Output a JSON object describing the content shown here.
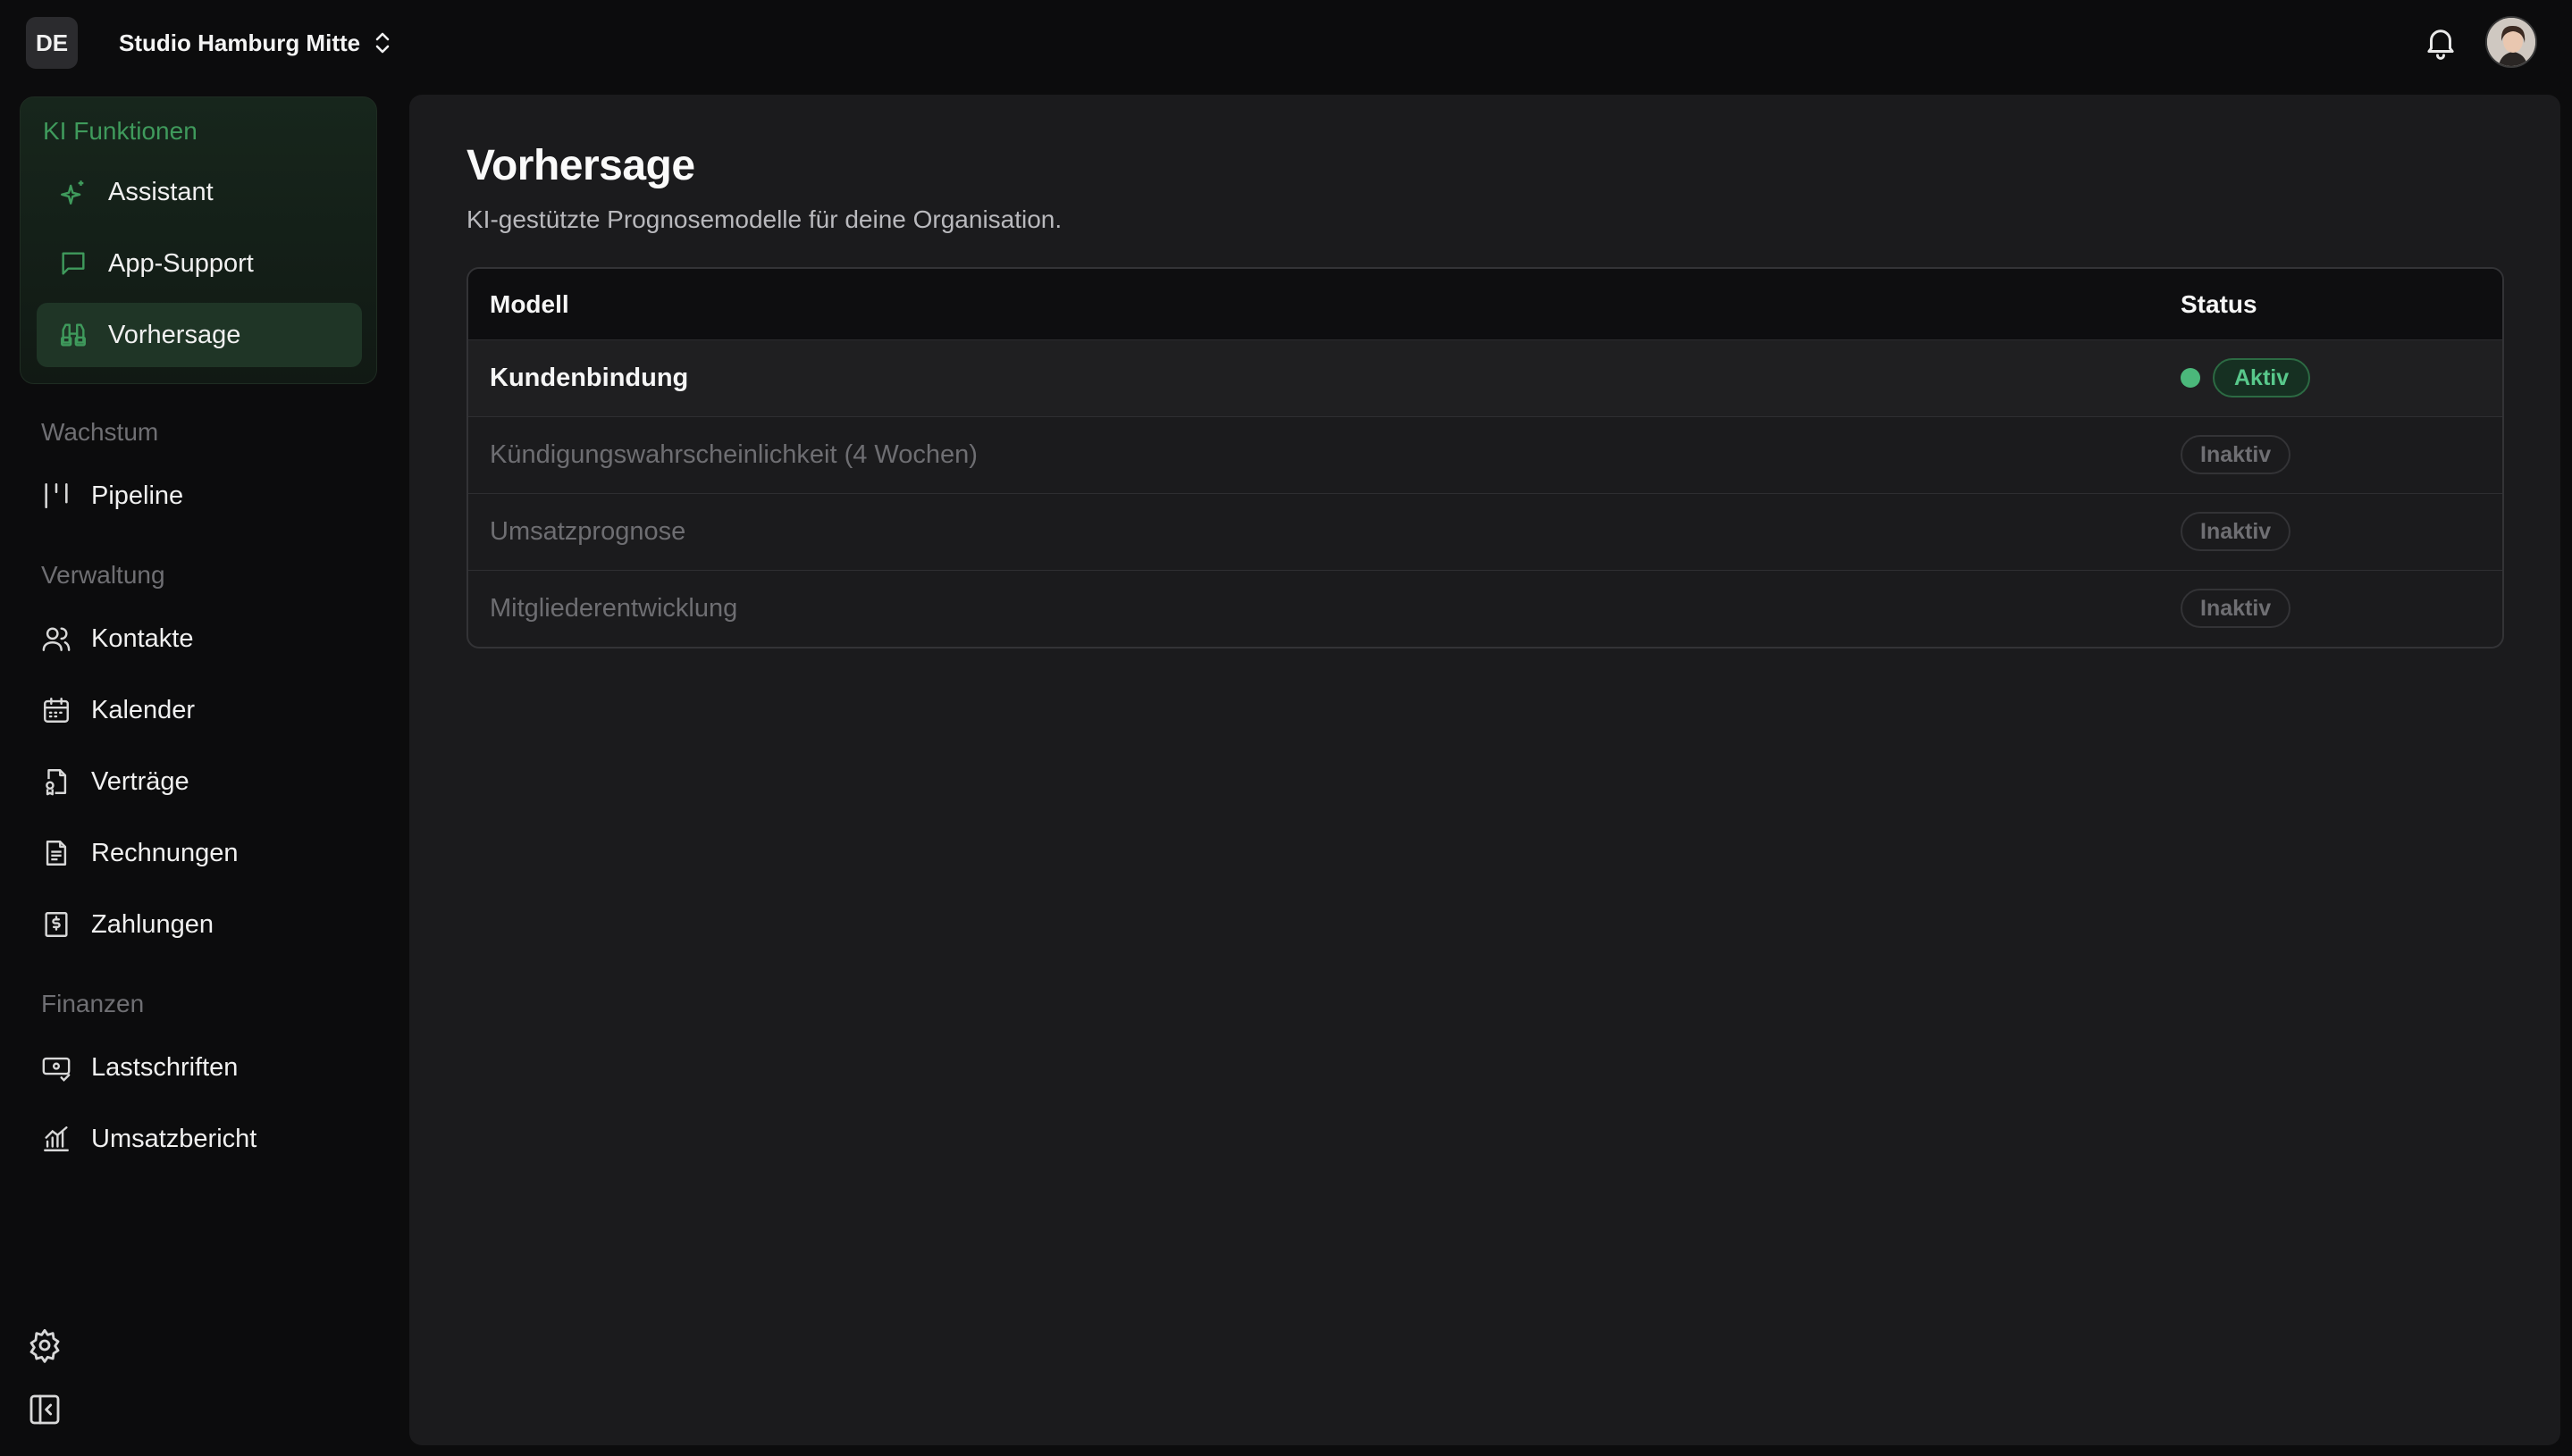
{
  "topbar": {
    "org_badge": "DE",
    "org_name": "Studio Hamburg Mitte"
  },
  "sidebar": {
    "ai_group_title": "KI Funktionen",
    "ai_items": [
      {
        "label": "Assistant",
        "icon": "sparkles-icon"
      },
      {
        "label": "App-Support",
        "icon": "chat-icon"
      },
      {
        "label": "Vorhersage",
        "icon": "binoculars-icon",
        "active": true
      }
    ],
    "sections": [
      {
        "title": "Wachstum",
        "items": [
          {
            "label": "Pipeline",
            "icon": "pipeline-icon"
          }
        ]
      },
      {
        "title": "Verwaltung",
        "items": [
          {
            "label": "Kontakte",
            "icon": "users-icon"
          },
          {
            "label": "Kalender",
            "icon": "calendar-icon"
          },
          {
            "label": "Verträge",
            "icon": "contract-icon"
          },
          {
            "label": "Rechnungen",
            "icon": "invoice-icon"
          },
          {
            "label": "Zahlungen",
            "icon": "payment-icon"
          }
        ]
      },
      {
        "title": "Finanzen",
        "items": [
          {
            "label": "Lastschriften",
            "icon": "direct-debit-icon"
          },
          {
            "label": "Umsatzbericht",
            "icon": "chart-icon"
          }
        ]
      }
    ]
  },
  "main": {
    "title": "Vorhersage",
    "subtitle": "KI-gestützte Prognosemodelle für deine Organisation.",
    "table": {
      "columns": [
        "Modell",
        "Status"
      ],
      "rows": [
        {
          "name": "Kundenbindung",
          "status": "Aktiv",
          "active": true
        },
        {
          "name": "Kündigungswahrscheinlichkeit (4 Wochen)",
          "status": "Inaktiv",
          "active": false
        },
        {
          "name": "Umsatzprognose",
          "status": "Inaktiv",
          "active": false
        },
        {
          "name": "Mitgliederentwicklung",
          "status": "Inaktiv",
          "active": false
        }
      ]
    }
  },
  "colors": {
    "accent": "#4bb87b",
    "background": "#0c0c0d",
    "panel": "#1b1b1d"
  }
}
